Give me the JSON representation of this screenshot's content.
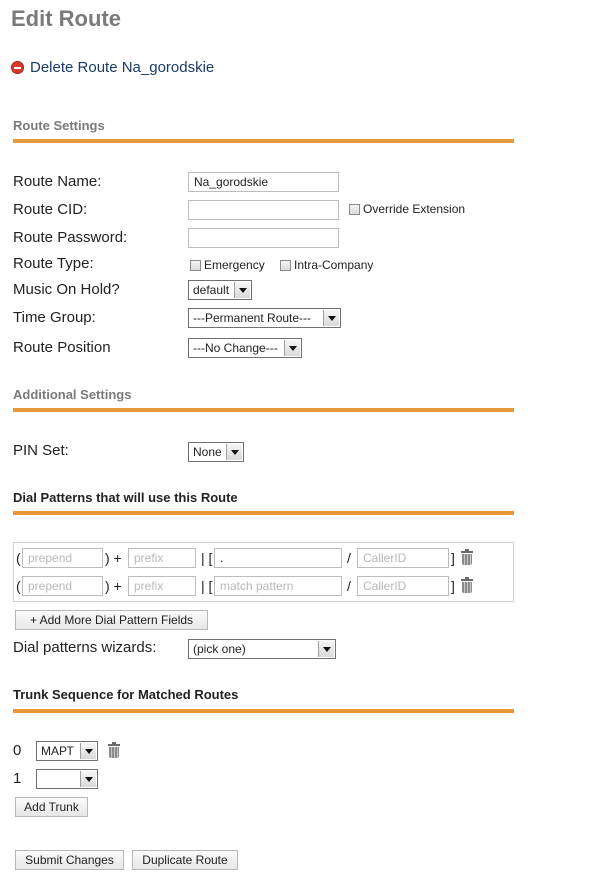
{
  "page": {
    "title": "Edit Route",
    "delete_link": "Delete Route Na_gorodskie"
  },
  "sections": {
    "route_settings": "Route Settings",
    "additional_settings": "Additional Settings",
    "dial_patterns": "Dial Patterns that will use this Route",
    "trunk_sequence": "Trunk Sequence for Matched Routes"
  },
  "route_settings": {
    "route_name_label": "Route Name:",
    "route_name_value": "Na_gorodskie",
    "route_cid_label": "Route CID:",
    "route_cid_value": "",
    "override_extension_label": "Override Extension",
    "route_password_label": "Route Password:",
    "route_password_value": "",
    "route_type_label": "Route Type:",
    "emergency_label": "Emergency",
    "intra_company_label": "Intra-Company",
    "music_on_hold_label": "Music On Hold?",
    "music_on_hold_value": "default",
    "time_group_label": "Time Group:",
    "time_group_value": "---Permanent Route---",
    "route_position_label": "Route Position",
    "route_position_value": "---No Change---"
  },
  "additional_settings": {
    "pin_set_label": "PIN Set:",
    "pin_set_value": "None"
  },
  "dial_patterns": {
    "open_paren": "(",
    "close_paren_plus": ") +",
    "bar_bracket": "| [",
    "slash": "/",
    "close_bracket": "]",
    "rows": [
      {
        "prepend_value": "",
        "prepend_placeholder": "prepend",
        "prefix_value": "",
        "prefix_placeholder": "prefix",
        "match_value": ".",
        "match_placeholder": "match pattern",
        "callerid_value": "",
        "callerid_placeholder": "CallerID"
      },
      {
        "prepend_value": "",
        "prepend_placeholder": "prepend",
        "prefix_value": "",
        "prefix_placeholder": "prefix",
        "match_value": "",
        "match_placeholder": "match pattern",
        "callerid_value": "",
        "callerid_placeholder": "CallerID"
      }
    ],
    "add_more_button": "+ Add More Dial Pattern Fields",
    "wizards_label": "Dial patterns wizards:",
    "wizards_value": "(pick one)"
  },
  "trunk_sequence": {
    "trunks": [
      {
        "index": "0",
        "value": "МАРТ"
      },
      {
        "index": "1",
        "value": ""
      }
    ],
    "add_trunk_button": "Add Trunk"
  },
  "actions": {
    "submit_button": "Submit Changes",
    "duplicate_button": "Duplicate Route"
  },
  "colors": {
    "section_rule": "#e8993a",
    "title_grey": "#7a7a7a",
    "delete_icon": "#d83a2a",
    "link": "#1a3a6a"
  },
  "icons": [
    "delete-icon",
    "trash-icon",
    "dropdown-arrow-icon"
  ]
}
